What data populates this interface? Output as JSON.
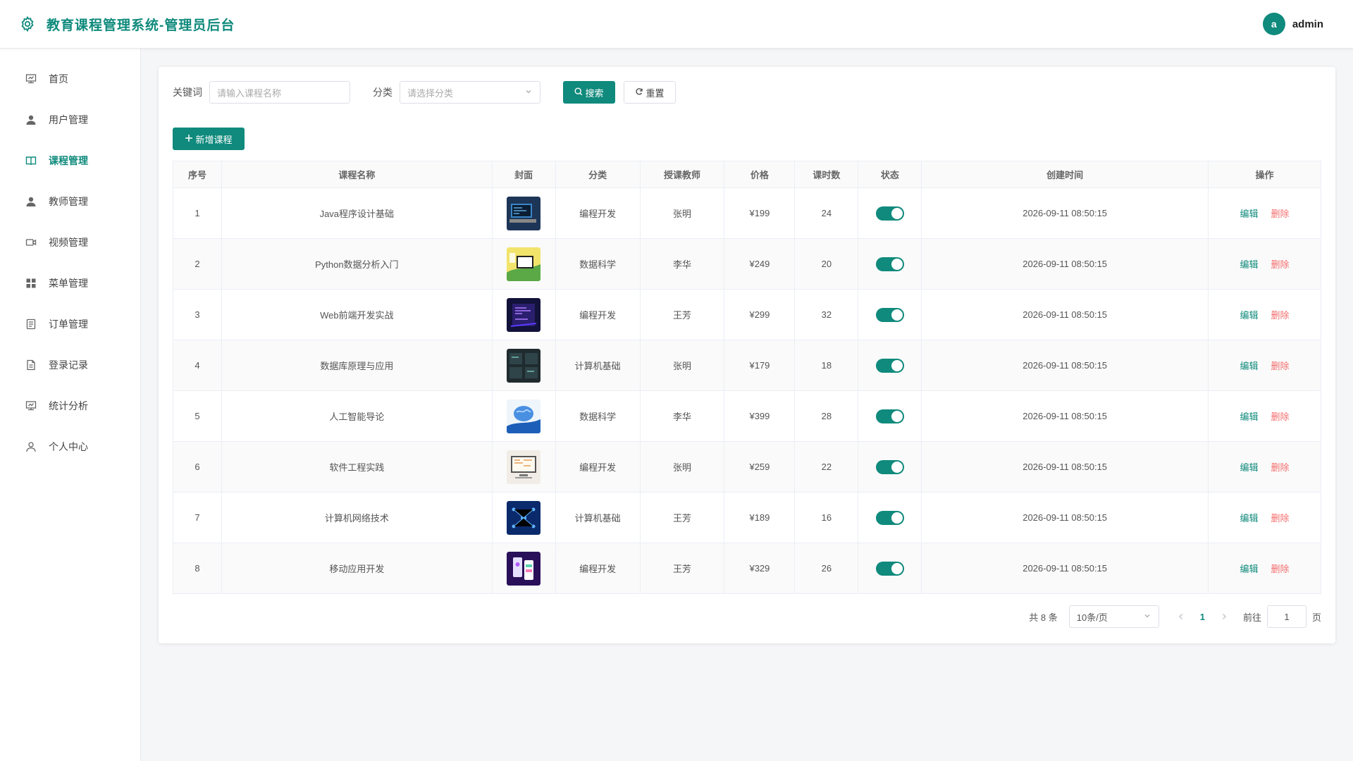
{
  "header": {
    "title": "教育课程管理系统-管理员后台",
    "avatar_letter": "a",
    "username": "admin",
    "accent": "#0f8a7c"
  },
  "sidebar": {
    "items": [
      {
        "label": "首页",
        "icon": "dashboard-icon"
      },
      {
        "label": "用户管理",
        "icon": "user-icon"
      },
      {
        "label": "课程管理",
        "icon": "book-icon",
        "active": true
      },
      {
        "label": "教师管理",
        "icon": "teacher-icon"
      },
      {
        "label": "视频管理",
        "icon": "video-icon"
      },
      {
        "label": "菜单管理",
        "icon": "grid-icon"
      },
      {
        "label": "订单管理",
        "icon": "order-icon"
      },
      {
        "label": "登录记录",
        "icon": "document-icon"
      },
      {
        "label": "统计分析",
        "icon": "chart-icon"
      },
      {
        "label": "个人中心",
        "icon": "person-icon"
      }
    ]
  },
  "search": {
    "keyword_label": "关键词",
    "keyword_placeholder": "请输入课程名称",
    "category_label": "分类",
    "category_placeholder": "请选择分类",
    "search_button": "搜索",
    "reset_button": "重置"
  },
  "add_button": "新增课程",
  "table": {
    "headers": [
      "序号",
      "课程名称",
      "封面",
      "分类",
      "授课教师",
      "价格",
      "课时数",
      "状态",
      "创建时间",
      "操作"
    ],
    "edit_label": "编辑",
    "delete_label": "删除",
    "rows": [
      {
        "no": "1",
        "name": "Java程序设计基础",
        "category": "编程开发",
        "teacher": "张明",
        "price": "¥199",
        "hours": "24",
        "enabled": true,
        "created": "2026-09-11 08:50:15"
      },
      {
        "no": "2",
        "name": "Python数据分析入门",
        "category": "数据科学",
        "teacher": "李华",
        "price": "¥249",
        "hours": "20",
        "enabled": true,
        "created": "2026-09-11 08:50:15"
      },
      {
        "no": "3",
        "name": "Web前端开发实战",
        "category": "编程开发",
        "teacher": "王芳",
        "price": "¥299",
        "hours": "32",
        "enabled": true,
        "created": "2026-09-11 08:50:15"
      },
      {
        "no": "4",
        "name": "数据库原理与应用",
        "category": "计算机基础",
        "teacher": "张明",
        "price": "¥179",
        "hours": "18",
        "enabled": true,
        "created": "2026-09-11 08:50:15"
      },
      {
        "no": "5",
        "name": "人工智能导论",
        "category": "数据科学",
        "teacher": "李华",
        "price": "¥399",
        "hours": "28",
        "enabled": true,
        "created": "2026-09-11 08:50:15"
      },
      {
        "no": "6",
        "name": "软件工程实践",
        "category": "编程开发",
        "teacher": "张明",
        "price": "¥259",
        "hours": "22",
        "enabled": true,
        "created": "2026-09-11 08:50:15"
      },
      {
        "no": "7",
        "name": "计算机网络技术",
        "category": "计算机基础",
        "teacher": "王芳",
        "price": "¥189",
        "hours": "16",
        "enabled": true,
        "created": "2026-09-11 08:50:15"
      },
      {
        "no": "8",
        "name": "移动应用开发",
        "category": "编程开发",
        "teacher": "王芳",
        "price": "¥329",
        "hours": "26",
        "enabled": true,
        "created": "2026-09-11 08:50:15"
      }
    ]
  },
  "pagination": {
    "total_text": "共 8 条",
    "page_size": "10条/页",
    "current_page": "1",
    "goto_label": "前往",
    "goto_value": "1",
    "page_suffix": "页"
  }
}
